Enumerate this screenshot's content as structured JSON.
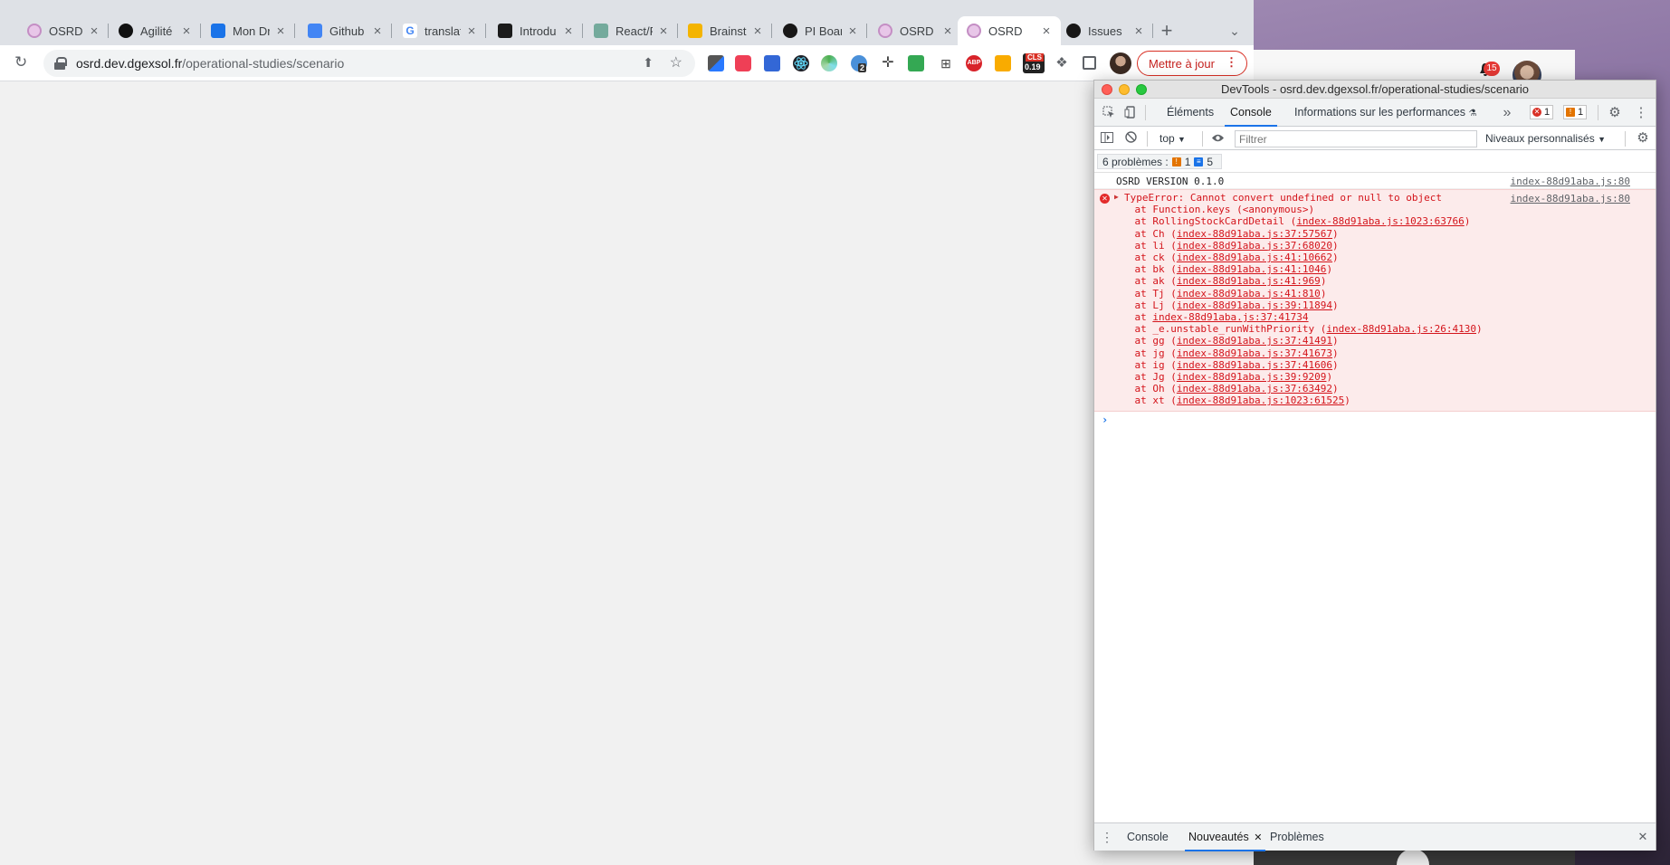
{
  "browser": {
    "tabs": [
      {
        "title": "OSRD",
        "icon": "osrd-icon",
        "color": "#e8c6e8"
      },
      {
        "title": "Agilité",
        "icon": "agility-icon",
        "color": "#111111"
      },
      {
        "title": "Mon Dr",
        "icon": "google-drive-icon",
        "color": "#1a73e8"
      },
      {
        "title": "Github",
        "icon": "google-docs-icon",
        "color": "#4285f4"
      },
      {
        "title": "translat",
        "icon": "google-icon",
        "color": "#ffffff"
      },
      {
        "title": "Introdu",
        "icon": "graphql-icon",
        "color": "#1b1b1b"
      },
      {
        "title": "React/R",
        "icon": "chatgpt-icon",
        "color": "#74aa9c"
      },
      {
        "title": "Brainst",
        "icon": "brainstorm-icon",
        "color": "#f4b400"
      },
      {
        "title": "PI Boar",
        "icon": "github-icon",
        "color": "#181717"
      },
      {
        "title": "OSRD",
        "icon": "osrd-icon",
        "color": "#e8c6e8"
      },
      {
        "title": "OSRD",
        "icon": "osrd-icon",
        "color": "#e8c6e8"
      },
      {
        "title": "Issues",
        "icon": "github-icon",
        "color": "#181717"
      }
    ],
    "active_tab_index": 10,
    "url_domain": "osrd.dev.dgexsol.fr",
    "url_path": "/operational-studies/scenario",
    "update_button_label": "Mettre à jour",
    "cls_badge": "CLS",
    "cls_value": "0.19",
    "ext_badge_count": "2",
    "notification_count": "15"
  },
  "devtools": {
    "window_title": "DevTools - osrd.dev.dgexsol.fr/operational-studies/scenario",
    "tabs": {
      "elements": "Éléments",
      "console": "Console",
      "performance": "Informations sur les performances"
    },
    "error_count": "1",
    "warning_count": "1",
    "context": "top",
    "filter_placeholder": "Filtrer",
    "levels_label": "Niveaux personnalisés",
    "issues_label": "6 problèmes :",
    "issues_warnings": "1",
    "issues_info": "5",
    "log": {
      "version_message": "OSRD VERSION 0.1.0",
      "version_source": "index-88d91aba.js:80",
      "error_source": "index-88d91aba.js:80",
      "error_message": "TypeError: Cannot convert undefined or null to object",
      "stack": [
        {
          "prefix": "    at Function.keys (<anonymous>)",
          "link": "",
          "suffix": ""
        },
        {
          "prefix": "    at RollingStockCardDetail (",
          "link": "index-88d91aba.js:1023:63766",
          "suffix": ")"
        },
        {
          "prefix": "    at Ch (",
          "link": "index-88d91aba.js:37:57567",
          "suffix": ")"
        },
        {
          "prefix": "    at li (",
          "link": "index-88d91aba.js:37:68020",
          "suffix": ")"
        },
        {
          "prefix": "    at ck (",
          "link": "index-88d91aba.js:41:10662",
          "suffix": ")"
        },
        {
          "prefix": "    at bk (",
          "link": "index-88d91aba.js:41:1046",
          "suffix": ")"
        },
        {
          "prefix": "    at ak (",
          "link": "index-88d91aba.js:41:969",
          "suffix": ")"
        },
        {
          "prefix": "    at Tj (",
          "link": "index-88d91aba.js:41:810",
          "suffix": ")"
        },
        {
          "prefix": "    at Lj (",
          "link": "index-88d91aba.js:39:11894",
          "suffix": ")"
        },
        {
          "prefix": "    at ",
          "link": "index-88d91aba.js:37:41734",
          "suffix": ""
        },
        {
          "prefix": "    at _e.unstable_runWithPriority (",
          "link": "index-88d91aba.js:26:4130",
          "suffix": ")"
        },
        {
          "prefix": "    at gg (",
          "link": "index-88d91aba.js:37:41491",
          "suffix": ")"
        },
        {
          "prefix": "    at jg (",
          "link": "index-88d91aba.js:37:41673",
          "suffix": ")"
        },
        {
          "prefix": "    at ig (",
          "link": "index-88d91aba.js:37:41606",
          "suffix": ")"
        },
        {
          "prefix": "    at Jg (",
          "link": "index-88d91aba.js:39:9209",
          "suffix": ")"
        },
        {
          "prefix": "    at Oh (",
          "link": "index-88d91aba.js:37:63492",
          "suffix": ")"
        },
        {
          "prefix": "    at xt (",
          "link": "index-88d91aba.js:1023:61525",
          "suffix": ")"
        }
      ]
    },
    "drawer": {
      "console": "Console",
      "whats_new": "Nouveautés",
      "issues": "Problèmes"
    }
  }
}
